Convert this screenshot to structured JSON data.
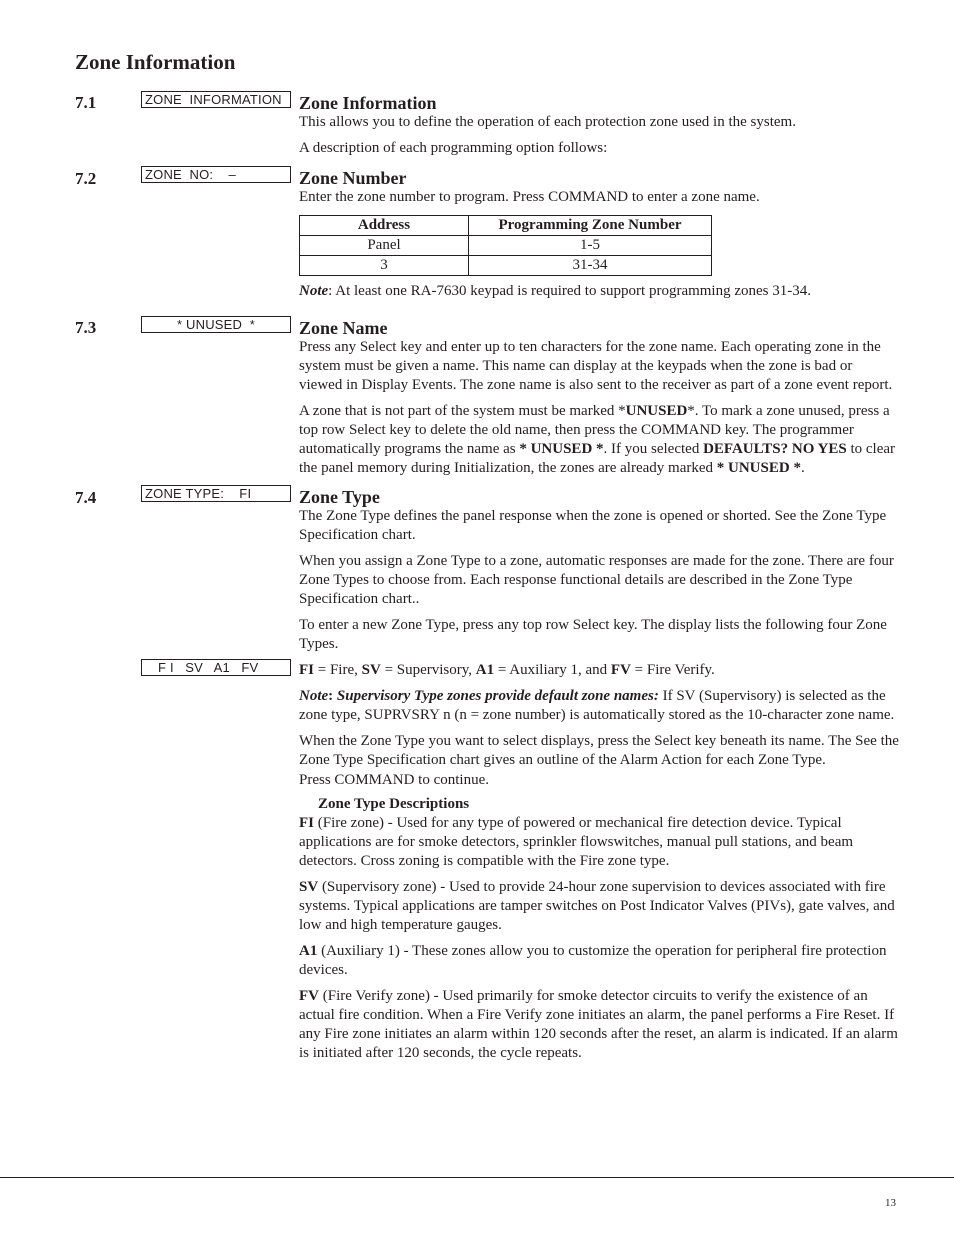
{
  "page_title": "Zone Information",
  "sections": [
    {
      "number": "7.1",
      "display": "ZONE  INFORMATION",
      "heading": "Zone Information",
      "paragraphs": [
        "This allows you to define the operation of each protection zone used in the system.",
        "A description of each programming option follows:"
      ]
    },
    {
      "number": "7.2",
      "display": "ZONE  NO:    –",
      "heading": "Zone Number",
      "paragraphs": [
        "Enter the zone number to program.  Press COMMAND to enter a zone name."
      ],
      "table": {
        "headers": [
          "Address",
          "Programming Zone Number"
        ],
        "rows": [
          [
            "Panel",
            "1-5"
          ],
          [
            "3",
            "31-34"
          ]
        ]
      },
      "note_label": "Note",
      "note_text": ": At least one RA-7630 keypad is required to support programming zones 31-34."
    },
    {
      "number": "7.3",
      "display": "* UNUSED  *",
      "heading": "Zone Name",
      "paragraphs": [
        "Press any Select key and enter up to ten characters for the zone name. Each operating zone in the system must be given a name. This name can display at the keypads when the zone is bad or viewed in Display Events. The zone name is also sent to the receiver as part of a zone event report."
      ],
      "unused_para": {
        "t1": "A zone that is not part of the system must be marked *",
        "b1": "UNUSED",
        "t2": "*. To mark a zone unused, press a top row Select key to delete the old name, then press the COMMAND key. The programmer automatically programs the name as ",
        "b2": "* UNUSED *",
        "t3": ". If you selected ",
        "b3": "DEFAULTS? NO YES",
        "t4": " to clear the panel memory during Initialization, the zones are already marked ",
        "b4": "* UNUSED *",
        "t5": "."
      }
    },
    {
      "number": "7.4",
      "display": "ZONE TYPE:    FI",
      "heading": "Zone Type",
      "paragraphs": [
        "The Zone Type defines the panel response when the zone is opened or shorted. See the Zone Type Specification chart.",
        "When you assign a Zone Type to a zone, automatic responses are made for the zone. There are four Zone Types to choose from. Each response functional details are described in the Zone Type Specification chart..",
        "To enter a new Zone Type, press any top row Select key. The display lists the following four Zone Types."
      ],
      "display2": "F I   SV   A1   FV",
      "legend": [
        {
          "code": "FI",
          "text": " = Fire, "
        },
        {
          "code": "SV",
          "text": " = Supervisory, "
        },
        {
          "code": "A1",
          "text": " = Auxiliary 1, and "
        },
        {
          "code": "FV",
          "text": " = Fire Verify."
        }
      ],
      "note": {
        "label": "Note",
        "colon": ":",
        "bold_italic": " Supervisory Type zones provide default zone names:",
        "text": " If SV (Supervisory) is selected as the zone type, SUPRVSRY  n (n = zone number) is automatically stored as the 10-character zone name."
      },
      "after_note": [
        "When the Zone Type you want to select displays, press the Select key beneath its name. The See the Zone Type Specification chart gives an outline of the Alarm Action for each Zone Type.",
        "Press COMMAND to continue."
      ],
      "descriptions_heading": "Zone Type Descriptions",
      "descriptions": [
        {
          "code": "FI",
          "text": " (Fire zone) - Used for any type of powered or mechanical fire detection device. Typical applications are for smoke detectors, sprinkler flowswitches, manual pull stations, and beam detectors. Cross zoning is compatible with the Fire zone type."
        },
        {
          "code": "SV",
          "text": " (Supervisory zone) - Used to provide 24-hour zone supervision to devices associated with fire systems. Typical applications are tamper switches on Post Indicator Valves (PIVs), gate valves, and low and high temperature gauges."
        },
        {
          "code": "A1",
          "text": " (Auxiliary 1) - These zones allow you to customize the operation for peripheral fire protection devices."
        },
        {
          "code": "FV",
          "text": " (Fire Verify zone) - Used primarily for smoke detector circuits to verify the existence of an actual fire condition. When a Fire Verify zone initiates an alarm, the panel performs a Fire Reset. If any Fire zone initiates an alarm within 120 seconds after the reset, an alarm is indicated. If an alarm is initiated after 120 seconds, the cycle repeats."
        }
      ]
    }
  ],
  "page_number": "13"
}
